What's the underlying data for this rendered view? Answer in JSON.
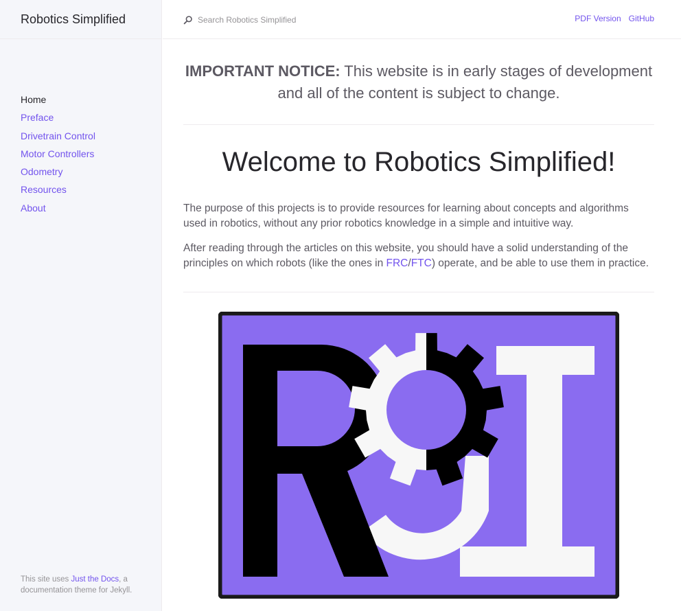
{
  "site": {
    "title": "Robotics Simplified"
  },
  "nav": {
    "items": [
      {
        "label": "Home",
        "active": true
      },
      {
        "label": "Preface"
      },
      {
        "label": "Drivetrain Control"
      },
      {
        "label": "Motor Controllers"
      },
      {
        "label": "Odometry"
      },
      {
        "label": "Resources"
      },
      {
        "label": "About"
      }
    ]
  },
  "footer": {
    "prefix": "This site uses ",
    "link": "Just the Docs",
    "suffix": ", a documentation theme for Jekyll."
  },
  "search": {
    "placeholder": "Search Robotics Simplified"
  },
  "aux_nav": {
    "pdf": "PDF Version",
    "github": "GitHub"
  },
  "notice": {
    "bold": "IMPORTANT NOTICE:",
    "text": " This website is in early stages of development and all of the content is subject to change."
  },
  "heading": "Welcome to Robotics Simplified!",
  "para1": "The purpose of this projects is to provide resources for learning about concepts and algorithms used in robotics, without any prior robotics knowledge in a simple and intuitive way.",
  "para2": {
    "before": "After reading through the articles on this website, you should have a solid understanding of the principles on which robots (like the ones in ",
    "link1": "FRC",
    "sep": "/",
    "link2": "FTC",
    "after": ") operate, and be able to use them in practice."
  },
  "logo": {
    "frame_color": "#1a1a1a",
    "bg_color": "#8a6cf0",
    "letter_color": "#000000",
    "light_color": "#f7f7f7"
  }
}
